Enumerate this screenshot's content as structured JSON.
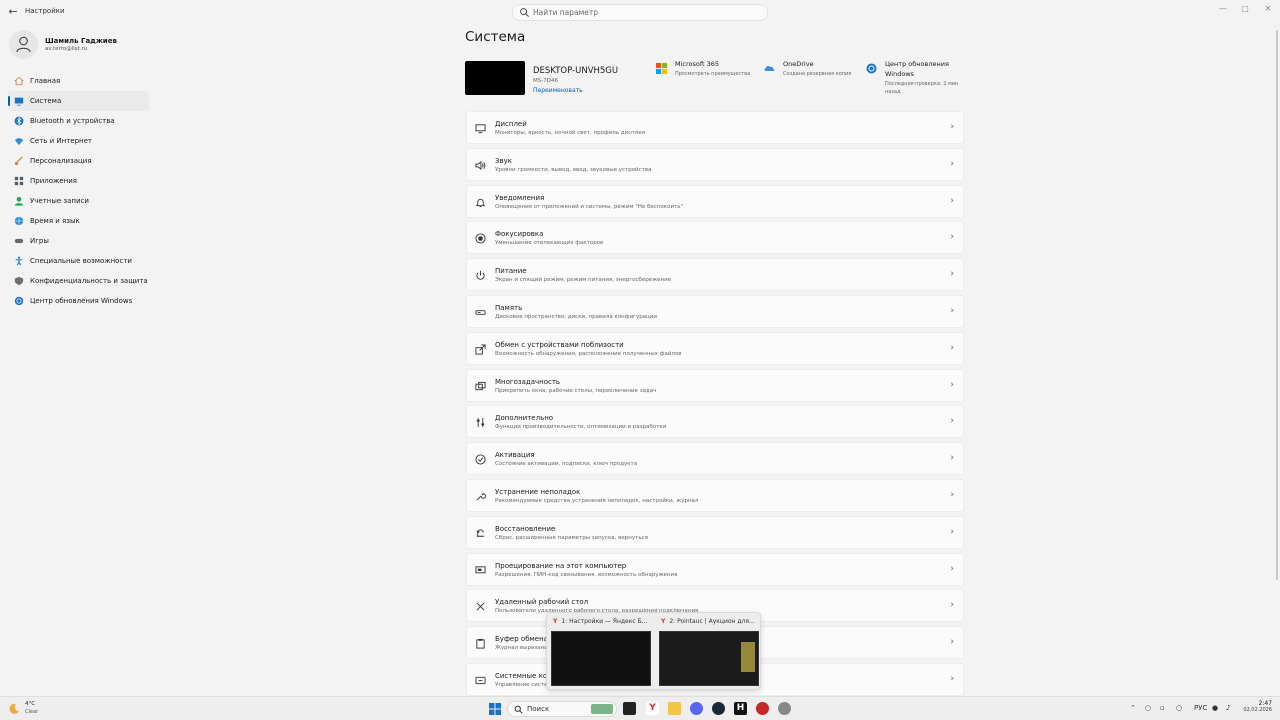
{
  "window": {
    "app_title": "Настройки",
    "search_placeholder": "Найти параметр"
  },
  "profile": {
    "name": "Шамиль Гаджиев",
    "email": "as.terro@list.ru"
  },
  "sidebar": {
    "items": [
      {
        "label": "Главная",
        "icon": "home-icon",
        "color": "#c9793a"
      },
      {
        "label": "Система",
        "icon": "system-icon",
        "color": "#1a73c8",
        "active": true
      },
      {
        "label": "Bluetooth и устройства",
        "icon": "bluetooth-icon",
        "color": "#1a73c8"
      },
      {
        "label": "Сеть и Интернет",
        "icon": "wifi-icon",
        "color": "#2c8fd6"
      },
      {
        "label": "Персонализация",
        "icon": "brush-icon",
        "color": "#d9822b"
      },
      {
        "label": "Приложения",
        "icon": "apps-icon",
        "color": "#555a66"
      },
      {
        "label": "Учетные записи",
        "icon": "account-icon",
        "color": "#2fa35a"
      },
      {
        "label": "Время и язык",
        "icon": "globe-icon",
        "color": "#2c8fd6"
      },
      {
        "label": "Игры",
        "icon": "gamepad-icon",
        "color": "#666a70"
      },
      {
        "label": "Специальные возможности",
        "icon": "accessibility-icon",
        "color": "#1a73c8"
      },
      {
        "label": "Конфиденциальность и защита",
        "icon": "shield-icon",
        "color": "#6b6f75"
      },
      {
        "label": "Центр обновления Windows",
        "icon": "update-icon",
        "color": "#1a73c8"
      }
    ]
  },
  "main": {
    "title": "Система",
    "device": {
      "name": "DESKTOP-UNVH5GU",
      "model": "MS-7D46",
      "rename_label": "Переименовать"
    },
    "quick_links": [
      {
        "title": "Microsoft 365",
        "subtitle": "Просмотреть преимущества",
        "icon": "microsoft-logo-icon"
      },
      {
        "title": "OneDrive",
        "subtitle": "Создана резервная копия",
        "icon": "onedrive-icon"
      },
      {
        "title": "Центр обновления",
        "title2": "Windows",
        "subtitle": "Последняя проверка: 2 мин",
        "subtitle2": "назад",
        "icon": "update-icon"
      }
    ],
    "settings": [
      {
        "title": "Дисплей",
        "subtitle": "Мониторы, яркость, ночной свет, профиль дисплея",
        "icon": "display-icon"
      },
      {
        "title": "Звук",
        "subtitle": "Уровни громкости, вывод, ввод, звуковые устройства",
        "icon": "speaker-icon"
      },
      {
        "title": "Уведомления",
        "subtitle": "Оповещения от приложений и системы, режим \"Не беспокоить\"",
        "icon": "bell-icon"
      },
      {
        "title": "Фокусировка",
        "subtitle": "Уменьшение отвлекающих факторов",
        "icon": "focus-icon"
      },
      {
        "title": "Питание",
        "subtitle": "Экран и спящий режим, режим питания, энергосбережение",
        "icon": "power-icon"
      },
      {
        "title": "Память",
        "subtitle": "Дисковое пространство, диски, правила конфигурации",
        "icon": "storage-icon"
      },
      {
        "title": "Обмен с устройствами поблизости",
        "subtitle": "Возможность обнаружения, расположение полученных файлов",
        "icon": "share-icon"
      },
      {
        "title": "Многозадачность",
        "subtitle": "Прикрепить окна, рабочие столы, переключение задач",
        "icon": "multitask-icon"
      },
      {
        "title": "Дополнительно",
        "subtitle": "Функции производительности, оптимизации и разработки",
        "icon": "advanced-icon"
      },
      {
        "title": "Активация",
        "subtitle": "Состояние активации, подписки, ключ продукта",
        "icon": "check-circle-icon"
      },
      {
        "title": "Устранение неполадок",
        "subtitle": "Рекомендуемые средства устранения неполадок, настройки, журнал",
        "icon": "wrench-icon"
      },
      {
        "title": "Восстановление",
        "subtitle": "Сброс, расширенные параметры запуска, вернуться",
        "icon": "recovery-icon"
      },
      {
        "title": "Проецирование на этот компьютер",
        "subtitle": "Разрешения, ПИН-код связывания, возможность обнаружения",
        "icon": "projection-icon"
      },
      {
        "title": "Удаленный рабочий стол",
        "subtitle": "Пользователи удаленного рабочего стола, разрешения подключения",
        "icon": "remote-desktop-icon"
      },
      {
        "title": "Буфер обмена",
        "subtitle": "Журнал вырезания",
        "icon": "clipboard-icon"
      },
      {
        "title": "Системные ком",
        "subtitle": "Управление систе",
        "icon": "components-icon"
      }
    ]
  },
  "task_preview": [
    {
      "title": "1: Настройки — Яндекс Б..."
    },
    {
      "title": "2: Pointauc | Аукцион для..."
    }
  ],
  "taskbar": {
    "weather_temp": "4°C",
    "weather_desc": "Clear",
    "search_label": "Поиск",
    "language": "РУС",
    "time": "2:47",
    "date": "02.02.2026"
  }
}
